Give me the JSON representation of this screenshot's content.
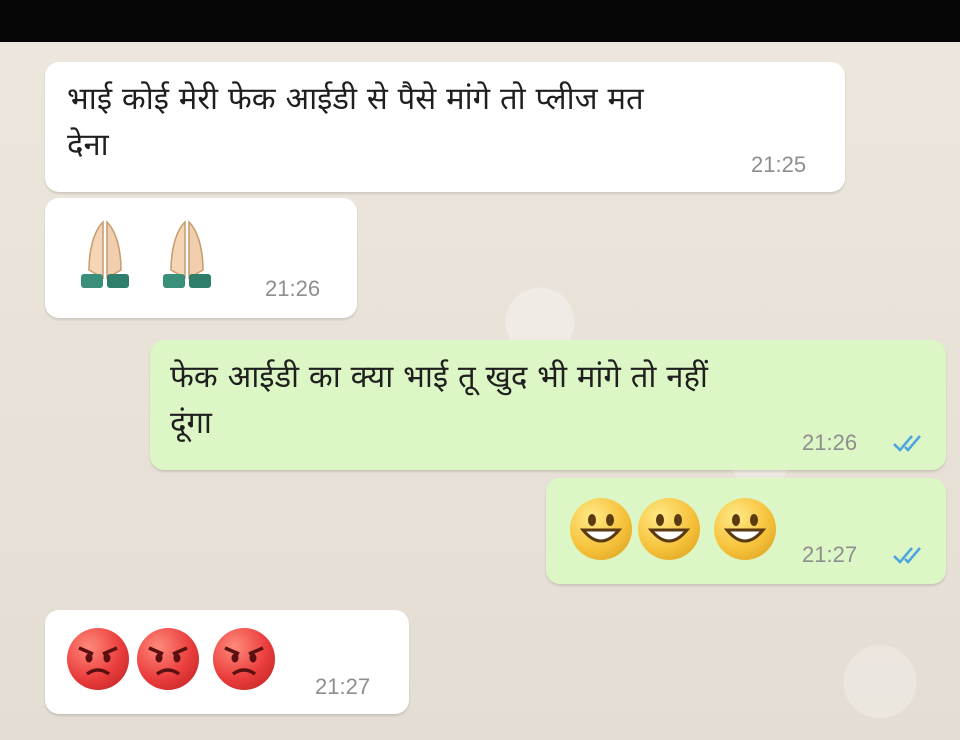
{
  "messages": [
    {
      "direction": "incoming",
      "text": "भाई कोई मेरी फेक आईडी से पैसे मांगे तो प्लीज मत देना",
      "text_lines": [
        "भाई कोई मेरी फेक आईडी से पैसे मांगे तो प्लीज मत",
        "देना"
      ],
      "time": "21:25"
    },
    {
      "direction": "incoming",
      "emoji": [
        "folded-hands",
        "folded-hands"
      ],
      "time": "21:26"
    },
    {
      "direction": "outgoing",
      "text": "फेक आईडी का क्या भाई तू खुद भी मांगे तो नहीं दूंगा",
      "text_lines": [
        "फेक आईडी का क्या भाई तू खुद भी मांगे तो नहीं",
        "दूंगा"
      ],
      "time": "21:26",
      "status": "read"
    },
    {
      "direction": "outgoing",
      "emoji": [
        "grinning-face",
        "grinning-face",
        "grinning-face"
      ],
      "time": "21:27",
      "status": "read"
    },
    {
      "direction": "incoming",
      "emoji": [
        "angry-face",
        "angry-face",
        "angry-face"
      ],
      "time": "21:27"
    }
  ],
  "colors": {
    "incoming_bubble": "#ffffff",
    "outgoing_bubble": "#dcf6c5",
    "read_ticks": "#4fa3e0",
    "chat_background": "#e9e3da",
    "status_bar": "#050505"
  }
}
